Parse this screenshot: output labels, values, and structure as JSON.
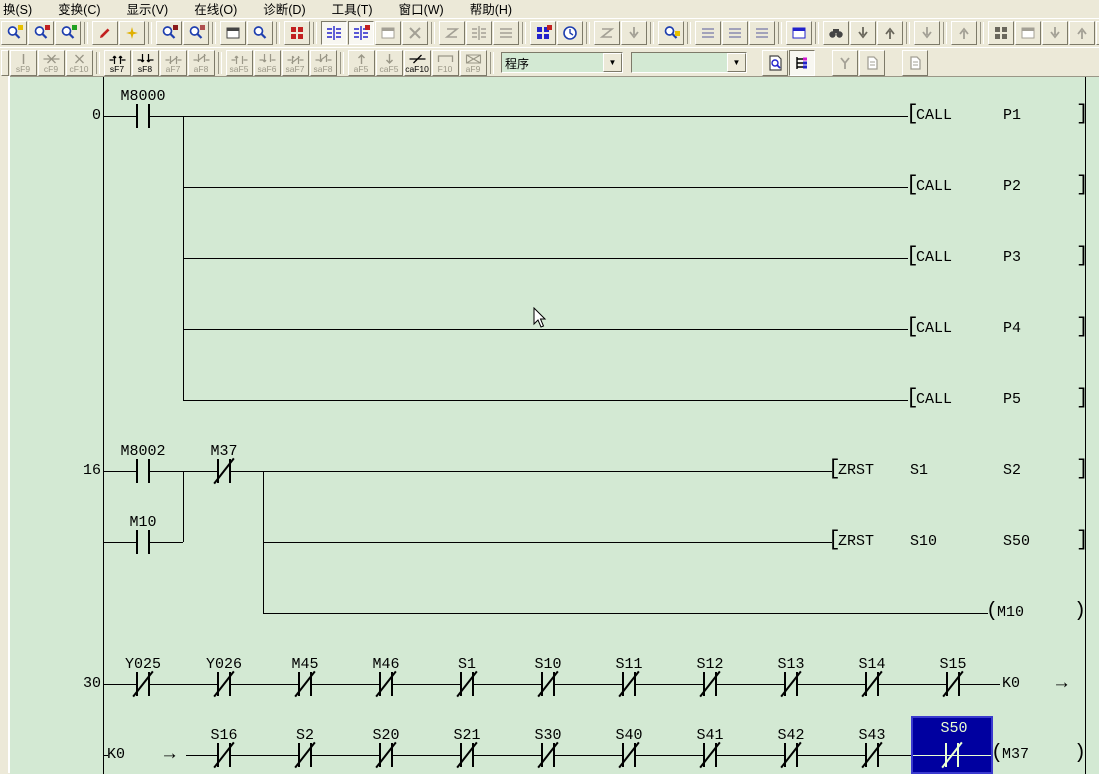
{
  "menu": {
    "items": [
      "换(S)",
      "变换(C)",
      "显示(V)",
      "在线(O)",
      "诊断(D)",
      "工具(T)",
      "窗口(W)",
      "帮助(H)"
    ]
  },
  "toolbar_main": {
    "icons": [
      "zoom-ladder-icon",
      "zoom-color-icon",
      "zoom-device-icon",
      "write-mode-icon",
      "write-new-icon",
      "read-mode-icon",
      "monitor-mode-icon",
      "window-split-icon",
      "zoom-circuit-icon",
      "ld-logo-icon",
      "ladder-view-icon",
      "ladder-edit-icon",
      "tel-monitor-icon",
      "monitor-stop-icon",
      "trace-icon",
      "partial-monitor-icon",
      "entry-monitor-icon",
      "device-batch-icon",
      "scan-time-icon",
      "device-test-icon",
      "skip-icon",
      "device-find-icon",
      "row-insert-icon",
      "row-delete-icon",
      "row-merge-icon",
      "watch-window-icon",
      "find-icon",
      "find-next-icon",
      "find-prev-icon",
      "jump-icon",
      "recall-icon",
      "device-memory-icon",
      "layers-icon",
      "col-insert-icon",
      "col-delete-icon",
      "col-clear-icon",
      "print-icon",
      "drag-icon",
      "to-bottom-icon",
      "transfer-icon"
    ]
  },
  "toolbar_ladder": {
    "buttons": [
      {
        "label": "sF9",
        "enabled": false
      },
      {
        "label": "cF9",
        "enabled": false
      },
      {
        "label": "cF10",
        "enabled": false
      },
      {
        "label": "sF7",
        "enabled": true
      },
      {
        "label": "sF8",
        "enabled": true
      },
      {
        "label": "aF7",
        "enabled": false
      },
      {
        "label": "aF8",
        "enabled": false
      },
      {
        "label": "saF5",
        "enabled": false
      },
      {
        "label": "saF6",
        "enabled": false
      },
      {
        "label": "saF7",
        "enabled": false
      },
      {
        "label": "saF8",
        "enabled": false
      },
      {
        "label": "aF5",
        "enabled": false
      },
      {
        "label": "caF5",
        "enabled": false
      },
      {
        "label": "caF10",
        "enabled": true
      },
      {
        "label": "F10",
        "enabled": false
      },
      {
        "label": "aF9",
        "enabled": false
      }
    ],
    "program_combo": {
      "value": "程序"
    },
    "second_combo": {
      "value": ""
    }
  },
  "ladder": {
    "background": "#d3e9d3",
    "selection_color": "#0000a0",
    "glyphs": {
      "lb": "[",
      "rb": "]",
      "lp": "(",
      "rp": ")",
      "arrow": "→"
    },
    "rung0": {
      "step": "0",
      "contact": "M8000",
      "calls": [
        {
          "op": "CALL",
          "operand": "P1"
        },
        {
          "op": "CALL",
          "operand": "P2"
        },
        {
          "op": "CALL",
          "operand": "P3"
        },
        {
          "op": "CALL",
          "operand": "P4"
        },
        {
          "op": "CALL",
          "operand": "P5"
        }
      ]
    },
    "rung16": {
      "step": "16",
      "contact1": "M8002",
      "contact2": "M37",
      "parallel": "M10",
      "zrst1": {
        "op": "ZRST",
        "a": "S1",
        "b": "S2"
      },
      "zrst2": {
        "op": "ZRST",
        "a": "S10",
        "b": "S50"
      },
      "coil": "M10"
    },
    "rung30": {
      "step": "30",
      "contacts": [
        "Y025",
        "Y026",
        "M45",
        "M46",
        "S1",
        "S10",
        "S11",
        "S12",
        "S13",
        "S14",
        "S15"
      ],
      "const": "K0"
    },
    "rung30b": {
      "const": "K0",
      "contacts": [
        "S16",
        "S2",
        "S20",
        "S21",
        "S30",
        "S40",
        "S41",
        "S42",
        "S43"
      ],
      "selected": "S50",
      "coil": "M37"
    }
  }
}
